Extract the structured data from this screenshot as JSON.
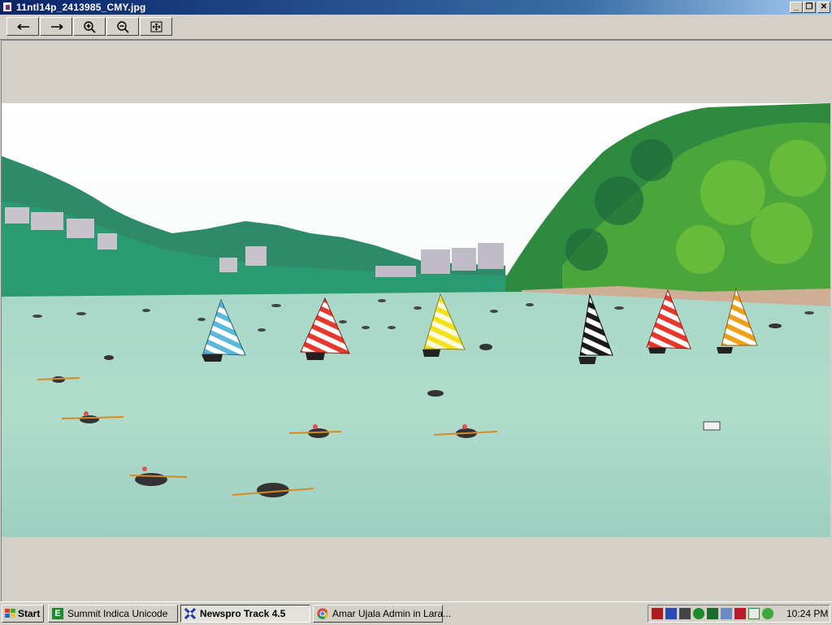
{
  "window": {
    "title": "11ntl14p_2413985_CMY.jpg",
    "minimize": "_",
    "restore": "❐",
    "close": "✕"
  },
  "toolbar": {
    "buttons": [
      "back-arrow-icon",
      "forward-arrow-icon",
      "zoom-in-icon",
      "zoom-out-icon",
      "fit-to-window-icon"
    ]
  },
  "taskbar": {
    "start_label": "Start",
    "tasks": [
      {
        "label": "Summit Indica Unicode",
        "active": false
      },
      {
        "label": "Newspro Track 4.5",
        "active": true
      },
      {
        "label": "Amar Ujala Admin in Lara...",
        "active": false
      }
    ],
    "clock": "10:24 PM"
  }
}
